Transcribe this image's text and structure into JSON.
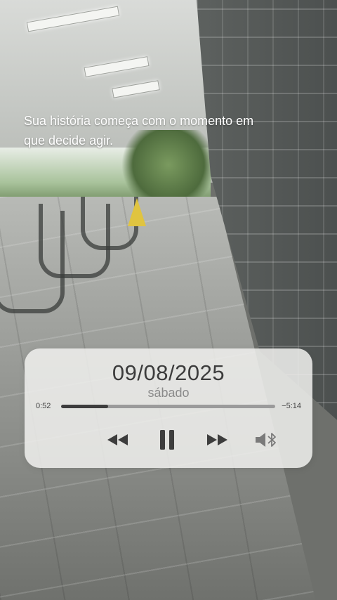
{
  "caption": {
    "line1": "Sua história começa com o momento em",
    "line2": "que decide agir."
  },
  "player": {
    "date": "09/08/2025",
    "weekday": "sábado",
    "elapsed": "0:52",
    "remaining": "−5:14",
    "progress": 0.22,
    "icons": [
      "rewind-icon",
      "pause-icon",
      "fast-forward-icon",
      "bluetooth-speaker-icon"
    ]
  },
  "colors": {
    "panel": "#f0f0ee",
    "track": "#9b9b9b",
    "track_fill": "#3d3d3d",
    "controls": "#3d3d3d",
    "muted": "#7a7a7a"
  }
}
